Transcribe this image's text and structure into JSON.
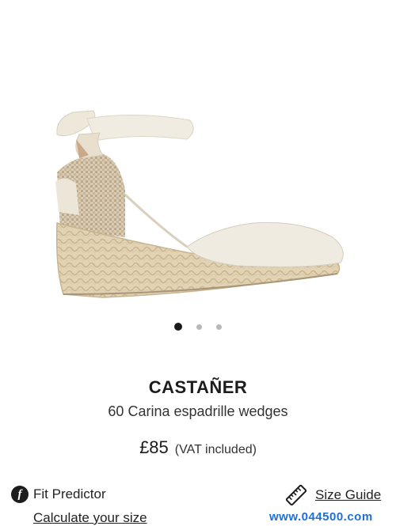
{
  "gallery": {
    "image_alt": "60 Carina espadrille wedges",
    "slide_count": 3,
    "active_slide": 1
  },
  "product": {
    "brand": "CASTAÑER",
    "name": "60 Carina espadrille wedges",
    "price": "£85",
    "vat_note": "(VAT included)"
  },
  "fit_predictor": {
    "icon": "fit-predictor-logo-icon",
    "label": "Fit Predictor",
    "link": "Calculate your size"
  },
  "size_guide": {
    "icon": "ruler-icon",
    "label": "Size Guide"
  },
  "watermark": "www.044500.com",
  "colors": {
    "text": "#222222",
    "dot_active": "#1a1a1a",
    "dot_inactive": "#b8b8b8",
    "watermark": "#1e6fd8"
  }
}
